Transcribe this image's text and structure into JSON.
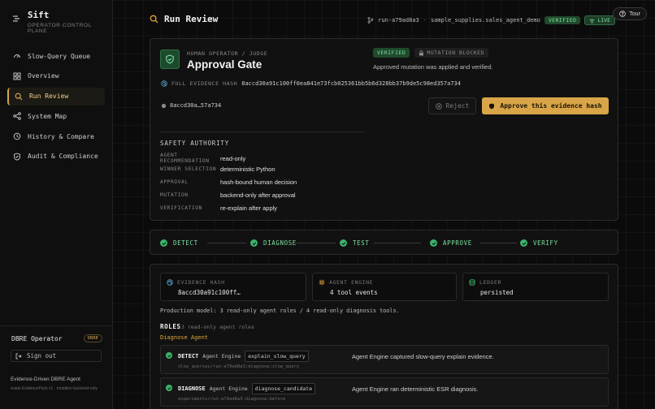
{
  "sidebar": {
    "brand_name": "Sift",
    "brand_sub": "OPERATOR CONTROL PLANE",
    "items": [
      {
        "label": "Slow-Query Queue",
        "icon": "gauge-icon"
      },
      {
        "label": "Overview",
        "icon": "grid-icon"
      },
      {
        "label": "Run Review",
        "icon": "magnifier-icon",
        "active": true
      },
      {
        "label": "System Map",
        "icon": "network-icon"
      },
      {
        "label": "History & Compare",
        "icon": "history-icon"
      },
      {
        "label": "Audit & Compliance",
        "icon": "shield-icon"
      }
    ],
    "operator_name": "DBRE Operator",
    "operator_badge": "DBRE",
    "sign_out": "Sign out",
    "footer_title": "Evidence-Driven DBRE Agent",
    "footer_text": "reads EvidencePack v1 · mutation backend-only"
  },
  "header": {
    "title": "Run Review",
    "run_id": "run-a79ad8a3",
    "table": "sample_supplies.sales_agent_demo",
    "verified": "VERIFIED",
    "live": "LIVE",
    "tour": "Tour"
  },
  "approval": {
    "eyebrow": "HUMAN OPERATOR / JUDGE",
    "title": "Approval Gate",
    "status_verified": "VERIFIED",
    "status_blocked": "MUTATION BLOCKED",
    "status_text": "Approved mutation was applied and verified.",
    "full_hash_label": "FULL EVIDENCE HASH",
    "full_hash": "8accd30a91c100ff0ea841e73fcb025361bb5b6d328bb37b9de5c98ed357a734",
    "short_hash": "8accd30a…57a734",
    "reject_label": "Reject",
    "approve_label": "Approve this evidence hash",
    "safety_title": "SAFETY AUTHORITY",
    "safety": [
      {
        "key": "AGENT RECOMMENDATION",
        "value": "read-only"
      },
      {
        "key": "WINNER SELECTION",
        "value": "deterministic Python"
      },
      {
        "key": "APPROVAL",
        "value": "hash-bound human decision"
      },
      {
        "key": "MUTATION",
        "value": "backend-only after approval"
      },
      {
        "key": "VERIFICATION",
        "value": "re-explain after apply"
      }
    ]
  },
  "pipeline": {
    "stages": [
      "DETECT",
      "DIAGNOSE",
      "TEST",
      "APPROVE",
      "VERIFY"
    ]
  },
  "evidence": {
    "cards": [
      {
        "label": "EVIDENCE HASH",
        "value": "8accd30a91c100ff…",
        "icon": "fingerprint-icon",
        "color": "#5aa6d8"
      },
      {
        "label": "AGENT ENGINE",
        "value": "4 tool events",
        "icon": "engine-icon",
        "color": "#e0a53c"
      },
      {
        "label": "LEDGER",
        "value": "persisted",
        "icon": "database-icon",
        "color": "#3bb36b"
      }
    ],
    "production_model": "Production model: 3 read-only agent roles / 4 read-only diagnosis tools.",
    "roles_title": "ROLES",
    "roles_sub": "3 read-only agent roles",
    "agent_name": "Diagnose Agent",
    "roles": [
      {
        "stage": "DETECT",
        "engine": "Agent Engine",
        "tool": "explain_slow_query",
        "path": "slow_queries/run-a79ad8a3:diagnose:slow_query",
        "desc": "Agent Engine captured slow-query explain evidence."
      },
      {
        "stage": "DIAGNOSE",
        "engine": "Agent Engine",
        "tool": "diagnose_candidate",
        "path": "experiments/run-a79ad8a3:diagnose:before",
        "desc": "Agent Engine ran deterministic ESR diagnosis."
      }
    ]
  },
  "colors": {
    "accent": "#d9a548",
    "success": "#3bb36b",
    "background": "#0b0b0b"
  }
}
